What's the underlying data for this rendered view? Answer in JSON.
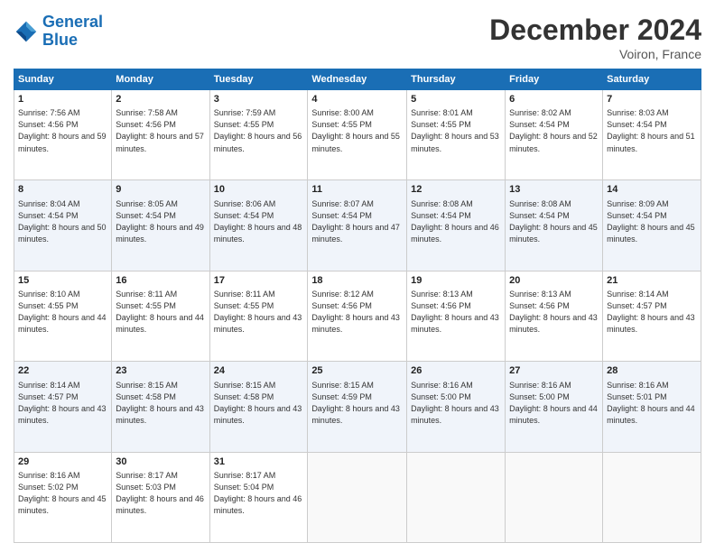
{
  "logo": {
    "line1": "General",
    "line2": "Blue"
  },
  "title": "December 2024",
  "location": "Voiron, France",
  "days_header": [
    "Sunday",
    "Monday",
    "Tuesday",
    "Wednesday",
    "Thursday",
    "Friday",
    "Saturday"
  ],
  "weeks": [
    [
      {
        "day": "1",
        "sunrise": "7:56 AM",
        "sunset": "4:56 PM",
        "daylight": "8 hours and 59 minutes."
      },
      {
        "day": "2",
        "sunrise": "7:58 AM",
        "sunset": "4:56 PM",
        "daylight": "8 hours and 57 minutes."
      },
      {
        "day": "3",
        "sunrise": "7:59 AM",
        "sunset": "4:55 PM",
        "daylight": "8 hours and 56 minutes."
      },
      {
        "day": "4",
        "sunrise": "8:00 AM",
        "sunset": "4:55 PM",
        "daylight": "8 hours and 55 minutes."
      },
      {
        "day": "5",
        "sunrise": "8:01 AM",
        "sunset": "4:55 PM",
        "daylight": "8 hours and 53 minutes."
      },
      {
        "day": "6",
        "sunrise": "8:02 AM",
        "sunset": "4:54 PM",
        "daylight": "8 hours and 52 minutes."
      },
      {
        "day": "7",
        "sunrise": "8:03 AM",
        "sunset": "4:54 PM",
        "daylight": "8 hours and 51 minutes."
      }
    ],
    [
      {
        "day": "8",
        "sunrise": "8:04 AM",
        "sunset": "4:54 PM",
        "daylight": "8 hours and 50 minutes."
      },
      {
        "day": "9",
        "sunrise": "8:05 AM",
        "sunset": "4:54 PM",
        "daylight": "8 hours and 49 minutes."
      },
      {
        "day": "10",
        "sunrise": "8:06 AM",
        "sunset": "4:54 PM",
        "daylight": "8 hours and 48 minutes."
      },
      {
        "day": "11",
        "sunrise": "8:07 AM",
        "sunset": "4:54 PM",
        "daylight": "8 hours and 47 minutes."
      },
      {
        "day": "12",
        "sunrise": "8:08 AM",
        "sunset": "4:54 PM",
        "daylight": "8 hours and 46 minutes."
      },
      {
        "day": "13",
        "sunrise": "8:08 AM",
        "sunset": "4:54 PM",
        "daylight": "8 hours and 45 minutes."
      },
      {
        "day": "14",
        "sunrise": "8:09 AM",
        "sunset": "4:54 PM",
        "daylight": "8 hours and 45 minutes."
      }
    ],
    [
      {
        "day": "15",
        "sunrise": "8:10 AM",
        "sunset": "4:55 PM",
        "daylight": "8 hours and 44 minutes."
      },
      {
        "day": "16",
        "sunrise": "8:11 AM",
        "sunset": "4:55 PM",
        "daylight": "8 hours and 44 minutes."
      },
      {
        "day": "17",
        "sunrise": "8:11 AM",
        "sunset": "4:55 PM",
        "daylight": "8 hours and 43 minutes."
      },
      {
        "day": "18",
        "sunrise": "8:12 AM",
        "sunset": "4:56 PM",
        "daylight": "8 hours and 43 minutes."
      },
      {
        "day": "19",
        "sunrise": "8:13 AM",
        "sunset": "4:56 PM",
        "daylight": "8 hours and 43 minutes."
      },
      {
        "day": "20",
        "sunrise": "8:13 AM",
        "sunset": "4:56 PM",
        "daylight": "8 hours and 43 minutes."
      },
      {
        "day": "21",
        "sunrise": "8:14 AM",
        "sunset": "4:57 PM",
        "daylight": "8 hours and 43 minutes."
      }
    ],
    [
      {
        "day": "22",
        "sunrise": "8:14 AM",
        "sunset": "4:57 PM",
        "daylight": "8 hours and 43 minutes."
      },
      {
        "day": "23",
        "sunrise": "8:15 AM",
        "sunset": "4:58 PM",
        "daylight": "8 hours and 43 minutes."
      },
      {
        "day": "24",
        "sunrise": "8:15 AM",
        "sunset": "4:58 PM",
        "daylight": "8 hours and 43 minutes."
      },
      {
        "day": "25",
        "sunrise": "8:15 AM",
        "sunset": "4:59 PM",
        "daylight": "8 hours and 43 minutes."
      },
      {
        "day": "26",
        "sunrise": "8:16 AM",
        "sunset": "5:00 PM",
        "daylight": "8 hours and 43 minutes."
      },
      {
        "day": "27",
        "sunrise": "8:16 AM",
        "sunset": "5:00 PM",
        "daylight": "8 hours and 44 minutes."
      },
      {
        "day": "28",
        "sunrise": "8:16 AM",
        "sunset": "5:01 PM",
        "daylight": "8 hours and 44 minutes."
      }
    ],
    [
      {
        "day": "29",
        "sunrise": "8:16 AM",
        "sunset": "5:02 PM",
        "daylight": "8 hours and 45 minutes."
      },
      {
        "day": "30",
        "sunrise": "8:17 AM",
        "sunset": "5:03 PM",
        "daylight": "8 hours and 46 minutes."
      },
      {
        "day": "31",
        "sunrise": "8:17 AM",
        "sunset": "5:04 PM",
        "daylight": "8 hours and 46 minutes."
      },
      null,
      null,
      null,
      null
    ]
  ]
}
